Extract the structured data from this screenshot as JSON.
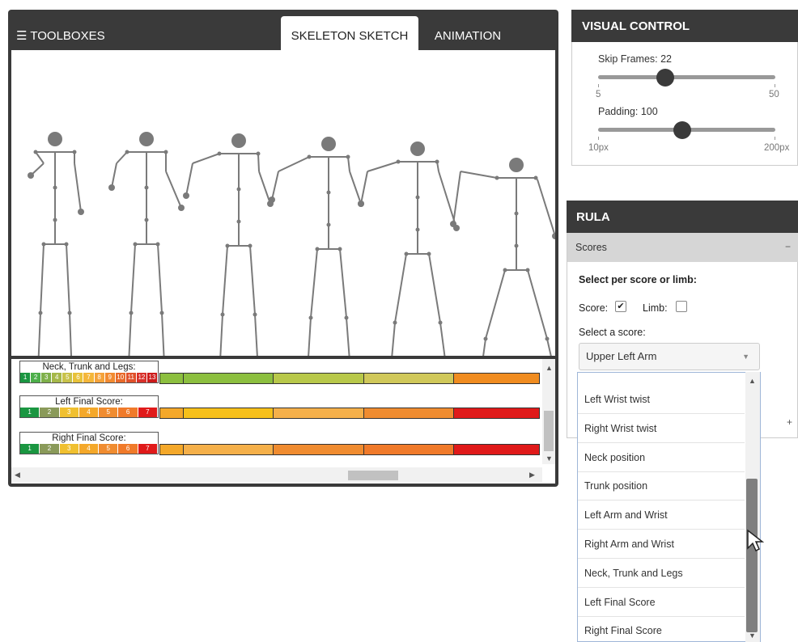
{
  "main": {
    "toolboxes_label": "☰ TOOLBOXES",
    "tabs": [
      {
        "label": "SKELETON SKETCH",
        "active": true
      },
      {
        "label": "ANIMATION",
        "active": false
      }
    ]
  },
  "score_legends": [
    {
      "title": "Neck, Trunk and Legs:",
      "cells": [
        "1",
        "2",
        "3",
        "4",
        "5",
        "6",
        "7",
        "8",
        "9",
        "10",
        "11",
        "12",
        "13"
      ],
      "colors": [
        "#1a9641",
        "#4daf4a",
        "#7fb04a",
        "#a6b84a",
        "#c8c24a",
        "#e8c23a",
        "#f4b63a",
        "#f5a23a",
        "#f28a30",
        "#e86a2a",
        "#e0502a",
        "#d8302a",
        "#cc1a1a"
      ],
      "bar": [
        "#8cbf3f",
        "#8cbf3f",
        "#b8c84a",
        "#d0c85a",
        "#f08c20"
      ]
    },
    {
      "title": "Left Final Score:",
      "cells": [
        "1",
        "2",
        "3",
        "4",
        "5",
        "6",
        "7"
      ],
      "colors": [
        "#1a9641",
        "#8a9a5a",
        "#f0c030",
        "#f4a82a",
        "#f08c30",
        "#f07a2a",
        "#e01a1a"
      ],
      "bar": [
        "#f4a82a",
        "#f7c01a",
        "#f5b04a",
        "#f08c30",
        "#e01a1a"
      ]
    },
    {
      "title": "Right Final Score:",
      "cells": [
        "1",
        "2",
        "3",
        "4",
        "5",
        "6",
        "7"
      ],
      "colors": [
        "#1a9641",
        "#8a9a5a",
        "#f0c030",
        "#f4a82a",
        "#f08c30",
        "#f07a2a",
        "#e01a1a"
      ],
      "bar": [
        "#f4a82a",
        "#f5b04a",
        "#f08c30",
        "#f07a2a",
        "#e01a1a"
      ]
    }
  ],
  "visual_control": {
    "title": "VISUAL CONTROL",
    "skip_frames": {
      "label": "Skip Frames: 22",
      "min": "5",
      "max": "50",
      "value": 22,
      "range": [
        5,
        50
      ]
    },
    "padding": {
      "label": "Padding: 100",
      "min": "10px",
      "max": "200px",
      "value": 100,
      "range": [
        10,
        200
      ]
    }
  },
  "rula": {
    "title": "RULA",
    "section": "Scores",
    "collapse_symbol": "−",
    "expand_symbol": "+",
    "prompt": "Select per score or limb:",
    "score_label": "Score:",
    "score_checked": true,
    "limb_label": "Limb:",
    "limb_checked": false,
    "select_label": "Select a score:",
    "selected": "Upper Left Arm",
    "options": [
      "Left Wrist twist",
      "Right Wrist twist",
      "Neck position",
      "Trunk position",
      "Left Arm and Wrist",
      "Right Arm and Wrist",
      "Neck, Trunk and Legs",
      "Left Final Score",
      "Right Final Score"
    ]
  },
  "colors": {
    "header_dark": "#3a3a3a",
    "skeleton": "#7a7a7a"
  }
}
